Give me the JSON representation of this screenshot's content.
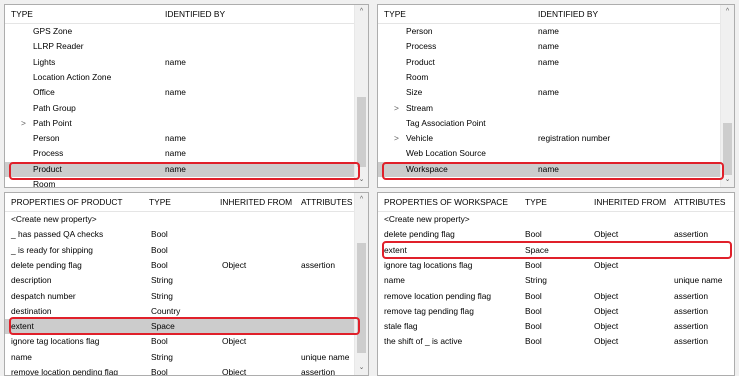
{
  "left_types": {
    "columns": [
      "TYPE",
      "IDENTIFIED BY"
    ],
    "rows": [
      {
        "name": "GPS Zone",
        "id": "",
        "expand": false
      },
      {
        "name": "LLRP Reader",
        "id": "",
        "expand": false
      },
      {
        "name": "Lights",
        "id": "name",
        "expand": false
      },
      {
        "name": "Location Action Zone",
        "id": "",
        "expand": false
      },
      {
        "name": "Office",
        "id": "name",
        "expand": false
      },
      {
        "name": "Path Group",
        "id": "",
        "expand": false
      },
      {
        "name": "Path Point",
        "id": "",
        "expand": true
      },
      {
        "name": "Person",
        "id": "name",
        "expand": false
      },
      {
        "name": "Process",
        "id": "name",
        "expand": false
      },
      {
        "name": "Product",
        "id": "name",
        "expand": false,
        "selected": true
      },
      {
        "name": "Room",
        "id": "",
        "expand": false
      }
    ]
  },
  "right_types": {
    "columns": [
      "TYPE",
      "IDENTIFIED BY"
    ],
    "rows": [
      {
        "name": "Person",
        "id": "name",
        "expand": false
      },
      {
        "name": "Process",
        "id": "name",
        "expand": false
      },
      {
        "name": "Product",
        "id": "name",
        "expand": false
      },
      {
        "name": "Room",
        "id": "",
        "expand": false
      },
      {
        "name": "Size",
        "id": "name",
        "expand": false
      },
      {
        "name": "Stream",
        "id": "",
        "expand": true
      },
      {
        "name": "Tag Association Point",
        "id": "",
        "expand": false
      },
      {
        "name": "Vehicle",
        "id": "registration number",
        "expand": true
      },
      {
        "name": "Web Location Source",
        "id": "",
        "expand": false
      },
      {
        "name": "Workspace",
        "id": "name",
        "expand": false,
        "selected": true
      }
    ]
  },
  "left_props": {
    "columns": [
      "PROPERTIES OF PRODUCT",
      "TYPE",
      "INHERITED FROM",
      "ATTRIBUTES"
    ],
    "rows": [
      [
        "<Create new property>",
        "",
        "",
        ""
      ],
      [
        "_ has passed QA checks",
        "Bool",
        "",
        ""
      ],
      [
        "_ is ready for shipping",
        "Bool",
        "",
        ""
      ],
      [
        "delete pending flag",
        "Bool",
        "Object",
        "assertion"
      ],
      [
        "description",
        "String",
        "",
        ""
      ],
      [
        "despatch number",
        "String",
        "",
        ""
      ],
      [
        "destination",
        "Country",
        "",
        ""
      ],
      [
        "extent",
        "Space",
        "",
        ""
      ],
      [
        "ignore tag locations flag",
        "Bool",
        "Object",
        ""
      ],
      [
        "name",
        "String",
        "",
        "unique name"
      ],
      [
        "remove location pending flag",
        "Bool",
        "Object",
        "assertion"
      ]
    ],
    "selected_index": 7
  },
  "right_props": {
    "columns": [
      "PROPERTIES OF WORKSPACE",
      "TYPE",
      "INHERITED FROM",
      "ATTRIBUTES"
    ],
    "rows": [
      [
        "<Create new property>",
        "",
        "",
        ""
      ],
      [
        "delete pending flag",
        "Bool",
        "Object",
        "assertion"
      ],
      [
        "extent",
        "Space",
        "",
        ""
      ],
      [
        "ignore tag locations flag",
        "Bool",
        "Object",
        ""
      ],
      [
        "name",
        "String",
        "",
        "unique name"
      ],
      [
        "remove location pending flag",
        "Bool",
        "Object",
        "assertion"
      ],
      [
        "remove tag pending flag",
        "Bool",
        "Object",
        "assertion"
      ],
      [
        "stale flag",
        "Bool",
        "Object",
        "assertion"
      ],
      [
        "the shift of _ is active",
        "Bool",
        "Object",
        "assertion"
      ]
    ],
    "selected_index": -1
  }
}
